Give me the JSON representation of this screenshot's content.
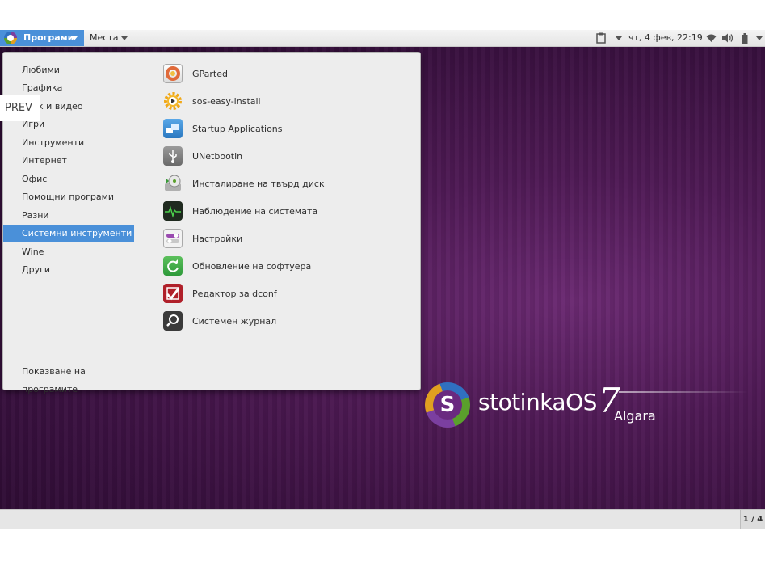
{
  "topbar": {
    "apps_label": "Програми",
    "places_label": "Места",
    "clock": "чт, 4 фев, 22:19"
  },
  "menu": {
    "categories": [
      {
        "label": "Любими"
      },
      {
        "label": "Графика"
      },
      {
        "label": "Звук и видео"
      },
      {
        "label": "Игри"
      },
      {
        "label": "Инструменти"
      },
      {
        "label": "Интернет"
      },
      {
        "label": "Офис"
      },
      {
        "label": "Помощни програми"
      },
      {
        "label": "Разни"
      },
      {
        "label": "Системни инструменти"
      },
      {
        "label": "Wine"
      },
      {
        "label": "Други"
      }
    ],
    "selected_category": "Системни инструменти",
    "show_apps": "Показване на програмите",
    "apps": [
      {
        "label": "GParted",
        "icon": "gparted-icon"
      },
      {
        "label": "sos-easy-install",
        "icon": "gear-icon"
      },
      {
        "label": "Startup Applications",
        "icon": "startup-apps-icon"
      },
      {
        "label": "UNetbootin",
        "icon": "usb-icon"
      },
      {
        "label": "Инсталиране на твърд диск",
        "icon": "disk-install-icon"
      },
      {
        "label": "Наблюдение на системата",
        "icon": "system-monitor-icon"
      },
      {
        "label": "Настройки",
        "icon": "toggles-icon"
      },
      {
        "label": "Обновление на софтуера",
        "icon": "refresh-icon"
      },
      {
        "label": "Редактор за dconf",
        "icon": "dconf-icon"
      },
      {
        "label": "Системен журнал",
        "icon": "magnifier-icon"
      }
    ]
  },
  "overlay": {
    "prev": "PREV"
  },
  "branding": {
    "name": "stotinkaOS",
    "version": "7",
    "codename": "Algara",
    "letter": "S"
  },
  "bottombar": {
    "pager": "1 / 4"
  }
}
